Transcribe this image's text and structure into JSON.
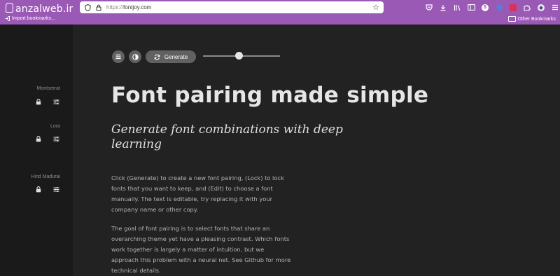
{
  "browser": {
    "watermark": "anzalweb.ir",
    "url_prefix": "https://",
    "url_domain": "fontjoy.com",
    "bookmarks": {
      "import_label": "Import bookmarks...",
      "other_label": "Other Bookmarks"
    },
    "accent_color": "#9b59b6"
  },
  "sidebar": {
    "fonts": [
      {
        "name": "Montserrat"
      },
      {
        "name": "Lora"
      },
      {
        "name": "Hind Madurai"
      }
    ]
  },
  "controls": {
    "generate_label": "Generate",
    "slider_level": 0.47
  },
  "content": {
    "headline": "Font pairing made simple",
    "subhead": "Generate font combinations with deep learning",
    "paragraphs": [
      "Click (Generate) to create a new font pairing, (Lock) to lock fonts that you want to keep, and (Edit) to choose a font manually. The text is editable, try replacing it with your company name or other copy.",
      "The goal of font pairing is to select fonts that share an overarching theme yet have a pleasing contrast. Which fonts work together is largely a matter of intuition, but we approach this problem with a neural net. See Github for more technical details."
    ]
  }
}
